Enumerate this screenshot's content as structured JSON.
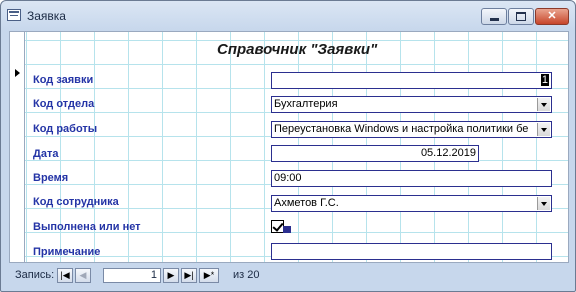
{
  "window": {
    "title": "Заявка"
  },
  "form": {
    "title": "Справочник \"Заявки\""
  },
  "fields": {
    "kod_zayavki": {
      "label": "Код заявки",
      "value": "1"
    },
    "kod_otdela": {
      "label": "Код отдела",
      "value": "Бухгалтерия"
    },
    "kod_raboty": {
      "label": "Код работы",
      "value": "Переустановка Windows и настройка политики бе"
    },
    "data": {
      "label": "Дата",
      "value": "05.12.2019"
    },
    "vremya": {
      "label": "Время",
      "value": "09:00"
    },
    "kod_sotrudnika": {
      "label": "Код сотрудника",
      "value": "Ахметов Г.С."
    },
    "vypolnena": {
      "label": "Выполнена или нет",
      "checked": true
    },
    "primechanie": {
      "label": "Примечание",
      "value": ""
    }
  },
  "navigation": {
    "label": "Запись:",
    "current": "1",
    "of_label": "из",
    "total": "20"
  }
}
